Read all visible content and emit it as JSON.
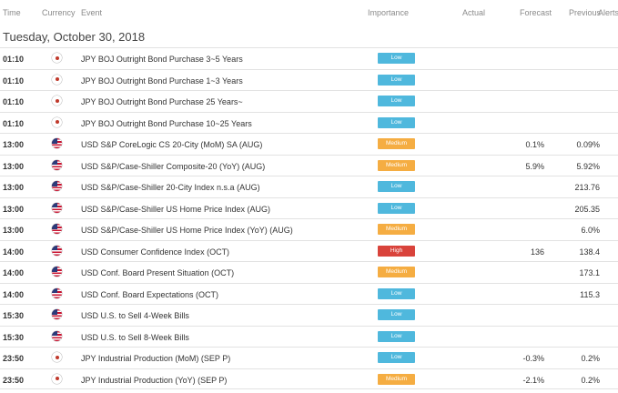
{
  "header": {
    "time": "Time",
    "currency": "Currency",
    "event": "Event",
    "importance": "Importance",
    "actual": "Actual",
    "forecast": "Forecast",
    "previous": "Previous",
    "alerts": "Alerts"
  },
  "date_heading": "Tuesday, October 30, 2018",
  "importance_colors": {
    "Low": "#4fb8dd",
    "Medium": "#f5ad42",
    "High": "#d9433b"
  },
  "rows": [
    {
      "time": "01:10",
      "flag": "jp-flag-icon",
      "event": "JPY BOJ Outright Bond Purchase 3~5 Years",
      "importance": "Low",
      "actual": "",
      "forecast": "",
      "previous": ""
    },
    {
      "time": "01:10",
      "flag": "jp-flag-icon",
      "event": "JPY BOJ Outright Bond Purchase 1~3 Years",
      "importance": "Low",
      "actual": "",
      "forecast": "",
      "previous": ""
    },
    {
      "time": "01:10",
      "flag": "jp-flag-icon",
      "event": "JPY BOJ Outright Bond Purchase 25 Years~",
      "importance": "Low",
      "actual": "",
      "forecast": "",
      "previous": ""
    },
    {
      "time": "01:10",
      "flag": "jp-flag-icon",
      "event": "JPY BOJ Outright Bond Purchase 10~25 Years",
      "importance": "Low",
      "actual": "",
      "forecast": "",
      "previous": ""
    },
    {
      "time": "13:00",
      "flag": "us-flag-icon",
      "event": "USD S&P CoreLogic CS 20-City (MoM) SA (AUG)",
      "importance": "Medium",
      "actual": "",
      "forecast": "0.1%",
      "previous": "0.09%"
    },
    {
      "time": "13:00",
      "flag": "us-flag-icon",
      "event": "USD S&P/Case-Shiller Composite-20 (YoY) (AUG)",
      "importance": "Medium",
      "actual": "",
      "forecast": "5.9%",
      "previous": "5.92%"
    },
    {
      "time": "13:00",
      "flag": "us-flag-icon",
      "event": "USD S&P/Case-Shiller 20-City Index n.s.a (AUG)",
      "importance": "Low",
      "actual": "",
      "forecast": "",
      "previous": "213.76"
    },
    {
      "time": "13:00",
      "flag": "us-flag-icon",
      "event": "USD S&P/Case-Shiller US Home Price Index (AUG)",
      "importance": "Low",
      "actual": "",
      "forecast": "",
      "previous": "205.35"
    },
    {
      "time": "13:00",
      "flag": "us-flag-icon",
      "event": "USD S&P/Case-Shiller US Home Price Index (YoY) (AUG)",
      "importance": "Medium",
      "actual": "",
      "forecast": "",
      "previous": "6.0%"
    },
    {
      "time": "14:00",
      "flag": "us-flag-icon",
      "event": "USD Consumer Confidence Index (OCT)",
      "importance": "High",
      "actual": "",
      "forecast": "136",
      "previous": "138.4"
    },
    {
      "time": "14:00",
      "flag": "us-flag-icon",
      "event": "USD Conf. Board Present Situation (OCT)",
      "importance": "Medium",
      "actual": "",
      "forecast": "",
      "previous": "173.1"
    },
    {
      "time": "14:00",
      "flag": "us-flag-icon",
      "event": "USD Conf. Board Expectations (OCT)",
      "importance": "Low",
      "actual": "",
      "forecast": "",
      "previous": "115.3"
    },
    {
      "time": "15:30",
      "flag": "us-flag-icon",
      "event": "USD U.S. to Sell 4-Week Bills",
      "importance": "Low",
      "actual": "",
      "forecast": "",
      "previous": ""
    },
    {
      "time": "15:30",
      "flag": "us-flag-icon",
      "event": "USD U.S. to Sell 8-Week Bills",
      "importance": "Low",
      "actual": "",
      "forecast": "",
      "previous": ""
    },
    {
      "time": "23:50",
      "flag": "jp-flag-icon",
      "event": "JPY Industrial Production (MoM) (SEP P)",
      "importance": "Low",
      "actual": "",
      "forecast": "-0.3%",
      "previous": "0.2%"
    },
    {
      "time": "23:50",
      "flag": "jp-flag-icon",
      "event": "JPY Industrial Production (YoY) (SEP P)",
      "importance": "Medium",
      "actual": "",
      "forecast": "-2.1%",
      "previous": "0.2%"
    }
  ]
}
